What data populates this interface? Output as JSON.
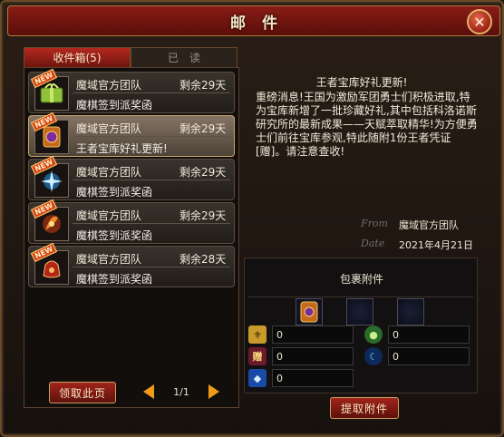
{
  "window": {
    "title": "邮件",
    "close_glyph": "✕"
  },
  "tabs": [
    {
      "label": "收件箱(5)",
      "active": true
    },
    {
      "label": "已读",
      "active": false
    }
  ],
  "mails": [
    {
      "badge": "NEW",
      "icon": "gift-box-icon",
      "sender": "魔域官方团队",
      "remain": "剩余29天",
      "subject": "魔棋签到派奖函",
      "selected": false
    },
    {
      "badge": "NEW",
      "icon": "treasure-icon",
      "sender": "魔域官方团队",
      "remain": "剩余29天",
      "subject": "王者宝库好礼更新!",
      "selected": true
    },
    {
      "badge": "NEW",
      "icon": "sparkle-icon",
      "sender": "魔域官方团队",
      "remain": "剩余29天",
      "subject": "魔棋签到派奖函",
      "selected": false
    },
    {
      "badge": "NEW",
      "icon": "flame-orb-icon",
      "sender": "魔域官方团队",
      "remain": "剩余29天",
      "subject": "魔棋签到派奖函",
      "selected": false
    },
    {
      "badge": "NEW",
      "icon": "red-bag-icon",
      "sender": "魔域官方团队",
      "remain": "剩余28天",
      "subject": "魔棋签到派奖函",
      "selected": false
    }
  ],
  "list_footer": {
    "claim_page_label": "领取此页",
    "page": "1/1"
  },
  "reader": {
    "subject": "王者宝库好礼更新!",
    "body": "重磅消息!王国为激励军团勇士们积极进取,特为宝库新增了一批珍藏好礼,其中包括科洛诺斯研究所的最新成果——天赋萃取精华!为方便勇士们前往宝库参观,特此随附1份王者凭证[赠]。请注意查收!",
    "from_label": "From",
    "from_value": "魔域官方团队",
    "date_label": "Date",
    "date_value": "2021年4月21日"
  },
  "attachments": {
    "title": "包裹附件",
    "slots": [
      "treasure-icon",
      "empty",
      "empty"
    ],
    "resources": [
      {
        "icon": "gold-coin-icon",
        "value": "0"
      },
      {
        "icon": "green-orb-icon",
        "value": "0"
      },
      {
        "icon": "gift-token-icon",
        "value": "0"
      },
      {
        "icon": "blue-moon-icon",
        "value": "0"
      },
      {
        "icon": "blue-gem-icon",
        "value": "0"
      }
    ],
    "extract_label": "提取附件"
  },
  "colors": {
    "accent_red": "#9c1f14",
    "gold_border": "#c9a066",
    "arrow": "#f09a18"
  }
}
